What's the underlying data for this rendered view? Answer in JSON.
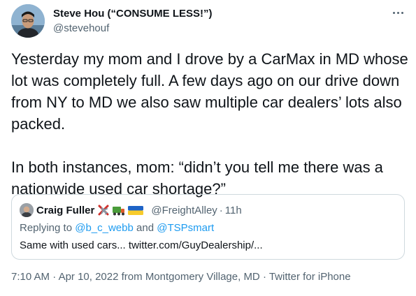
{
  "author": {
    "name": "Steve Hou (“CONSUME LESS!”)",
    "handle": "@stevehouf"
  },
  "tweet": {
    "text": "Yesterday my mom and I drove by a CarMax in MD whose lot was completely full. A few days ago on our drive down from NY to MD we also saw multiple car dealers’ lots also packed.\n\nIn both instances, mom: “didn’t you tell me there was a nationwide used car shortage?”"
  },
  "quoted_tweet": {
    "name": "Craig Fuller",
    "emoji_icons": [
      "cross-x-icon",
      "airplane-icon",
      "truck-icon",
      "ukraine-flag-icon"
    ],
    "handle": "@FreightAlley",
    "separator": "·",
    "time": "11h",
    "replying_prefix": "Replying to",
    "reply_to_1": "@b_c_webb",
    "reply_and": "and",
    "reply_to_2": "@TSPsmart",
    "text": "Same with used cars... twitter.com/GuyDealership/..."
  },
  "meta": {
    "time": "7:10 AM",
    "sep": "·",
    "date": "Apr 10, 2022",
    "from": "from",
    "location": "Montgomery Village, MD",
    "client": "Twitter for iPhone"
  },
  "colors": {
    "text": "#0f1419",
    "secondary": "#536471",
    "link": "#1d9bf0",
    "border": "#cfd9de"
  }
}
